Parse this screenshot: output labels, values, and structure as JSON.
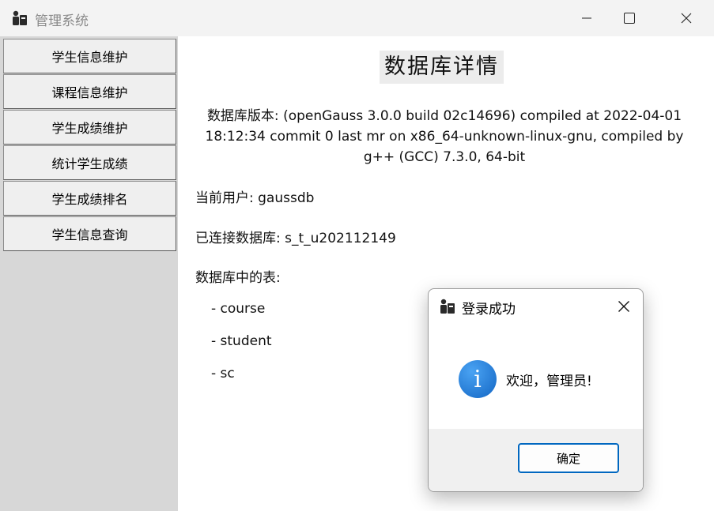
{
  "window": {
    "title": "管理系统"
  },
  "sidebar": {
    "items": [
      {
        "label": "学生信息维护"
      },
      {
        "label": "课程信息维护"
      },
      {
        "label": "学生成绩维护"
      },
      {
        "label": "统计学生成绩"
      },
      {
        "label": "学生成绩排名"
      },
      {
        "label": "学生信息查询"
      }
    ]
  },
  "main": {
    "title": "数据库详情",
    "version_lines": [
      "数据库版本: (openGauss 3.0.0 build 02c14696) compiled at 2022-04-01",
      "18:12:34 commit 0 last mr   on x86_64-unknown-linux-gnu, compiled by",
      "g++ (GCC) 7.3.0, 64-bit"
    ],
    "current_user": "当前用户: gaussdb",
    "connected_db": "已连接数据库: s_t_u202112149",
    "tables_label": "数据库中的表:",
    "tables": [
      "- course",
      "- student",
      "- sc"
    ]
  },
  "dialog": {
    "title": "登录成功",
    "message": "欢迎，管理员!",
    "ok_label": "确定",
    "info_glyph": "i"
  }
}
